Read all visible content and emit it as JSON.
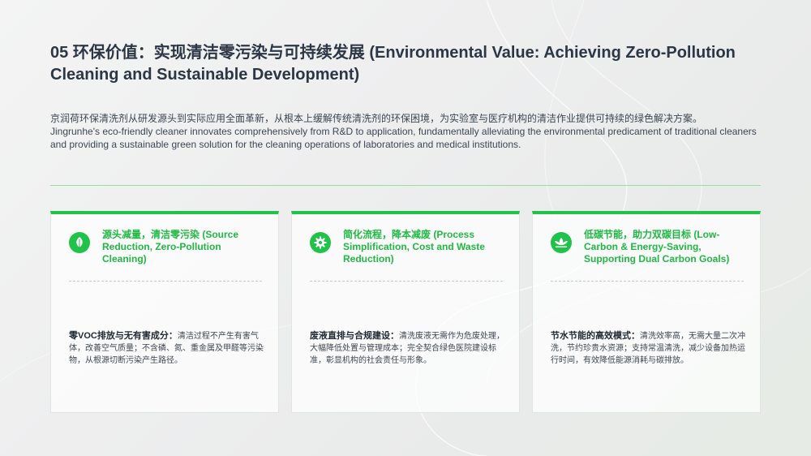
{
  "header": {
    "title": "05 环保价值：实现清洁零污染与可持续发展 (Environmental Value: Achieving Zero-Pollution Cleaning and Sustainable Development)"
  },
  "intro": {
    "zh": "京润荷环保清洗剂从研发源头到实际应用全面革新，从根本上缓解传统清洗剂的环保困境，为实验室与医疗机构的清洁作业提供可持续的绿色解决方案。",
    "en": "Jingrunhe's eco-friendly cleaner innovates comprehensively from R&D to application, fundamentally alleviating the environmental predicament of traditional cleaners and providing a sustainable green solution for the cleaning operations of laboratories and medical institutions."
  },
  "colors": {
    "accent": "#21c24a",
    "title": "#2c3644",
    "divider": "#9fd9a6"
  },
  "cards": [
    {
      "icon": "leaf-icon",
      "title": "源头减量，清洁零污染 (Source Reduction, Zero-Pollution Cleaning)",
      "body_label": "零VOC排放与无有害成分：",
      "body_text": "清洁过程不产生有害气体，改善空气质量；不含磷、氮、重金属及甲醛等污染物，从根源切断污染产生路径。"
    },
    {
      "icon": "gear-icon",
      "title": "简化流程，降本减废 (Process Simplification, Cost and Waste Reduction)",
      "body_label": "废液直排与合规建设：",
      "body_text": "清洗废液无需作为危废处理，大幅降低处置与管理成本；完全契合绿色医院建设标准，彰显机构的社会责任与形象。"
    },
    {
      "icon": "lotus-icon",
      "title": "低碳节能，助力双碳目标 (Low-Carbon & Energy-Saving, Supporting Dual Carbon Goals)",
      "body_label": "节水节能的高效模式：",
      "body_text": "清洗效率高，无需大量二次冲洗，节约珍贵水资源；支持常温清洗，减少设备加热运行时间，有效降低能源消耗与碳排放。"
    }
  ]
}
